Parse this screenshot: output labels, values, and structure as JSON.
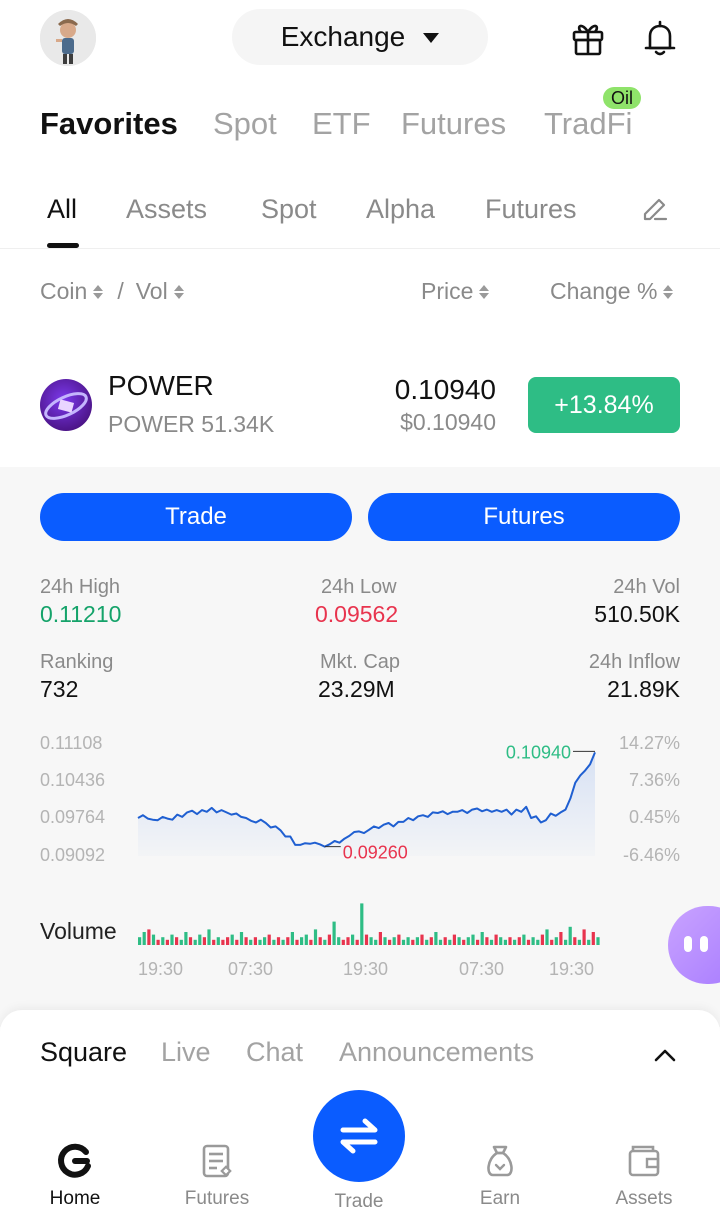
{
  "header": {
    "exchange_label": "Exchange",
    "icons": [
      "avatar",
      "chevron-down-icon",
      "gift-icon",
      "bell-icon"
    ]
  },
  "primary_tabs": [
    {
      "label": "Favorites",
      "active": true
    },
    {
      "label": "Spot",
      "active": false
    },
    {
      "label": "ETF",
      "active": false
    },
    {
      "label": "Futures",
      "active": false
    },
    {
      "label": "TradFi",
      "active": false,
      "badge": "Oil"
    }
  ],
  "secondary_tabs": [
    {
      "label": "All",
      "active": true
    },
    {
      "label": "Assets",
      "active": false
    },
    {
      "label": "Spot",
      "active": false
    },
    {
      "label": "Alpha",
      "active": false
    },
    {
      "label": "Futures",
      "active": false
    }
  ],
  "columns": {
    "coin": "Coin",
    "separator": "/",
    "vol": "Vol",
    "price": "Price",
    "change": "Change %"
  },
  "coin": {
    "symbol": "POWER",
    "sub": "POWER 51.34K",
    "price": "0.10940",
    "price_usd": "$0.10940",
    "change": "+13.84%",
    "colors": {
      "up": "#2ebd85",
      "down": "#e8344e",
      "accent": "#0a5cff"
    }
  },
  "actions": {
    "trade": "Trade",
    "futures": "Futures"
  },
  "stats": {
    "high_label": "24h High",
    "high": "0.11210",
    "low_label": "24h Low",
    "low": "0.09562",
    "vol_label": "24h Vol",
    "vol": "510.50K",
    "rank_label": "Ranking",
    "rank": "732",
    "cap_label": "Mkt. Cap",
    "cap": "23.29M",
    "inflow_label": "24h Inflow",
    "inflow": "21.89K"
  },
  "chart_data": {
    "type": "line",
    "y_ticks": [
      "0.11108",
      "0.10436",
      "0.09764",
      "0.09092"
    ],
    "y_pct_ticks": [
      "14.27%",
      "7.36%",
      "0.45%",
      "-6.46%"
    ],
    "ylim": [
      0.09092,
      0.11108
    ],
    "max_label": "0.10940",
    "min_label": "0.09260",
    "values": [
      0.0977,
      0.0982,
      0.0976,
      0.0974,
      0.0973,
      0.0979,
      0.0976,
      0.0974,
      0.0983,
      0.0979,
      0.0987,
      0.099,
      0.0984,
      0.0991,
      0.0988,
      0.0995,
      0.0987,
      0.0991,
      0.0987,
      0.0983,
      0.0985,
      0.0979,
      0.0977,
      0.0972,
      0.0969,
      0.0974,
      0.0968,
      0.096,
      0.0962,
      0.0955,
      0.0944,
      0.0944,
      0.0929,
      0.0929,
      0.0932,
      0.0931,
      0.0933,
      0.093,
      0.0926,
      0.093,
      0.0936,
      0.0933,
      0.094,
      0.0945,
      0.0952,
      0.0953,
      0.095,
      0.0956,
      0.0962,
      0.0959,
      0.0965,
      0.0968,
      0.0962,
      0.097,
      0.097,
      0.0977,
      0.0973,
      0.098,
      0.0982,
      0.0979,
      0.0987,
      0.0986,
      0.0989,
      0.0984,
      0.0988,
      0.0988,
      0.0991,
      0.0986,
      0.0992,
      0.0994,
      0.0989,
      0.0992,
      0.0988,
      0.0991,
      0.0988,
      0.0992,
      0.0983,
      0.0992,
      0.0988,
      0.0997,
      0.0977,
      0.098,
      0.0969,
      0.0973,
      0.0985,
      0.0981,
      0.0987,
      0.0992,
      0.1012,
      0.104,
      0.1053,
      0.1062,
      0.1073,
      0.1094
    ],
    "volume_label": "Volume",
    "volume": [
      3,
      5,
      6,
      4,
      2,
      3,
      2,
      4,
      3,
      2,
      5,
      3,
      2,
      4,
      3,
      6,
      2,
      3,
      2,
      3,
      4,
      2,
      5,
      3,
      2,
      3,
      2,
      3,
      4,
      2,
      3,
      2,
      3,
      5,
      2,
      3,
      4,
      2,
      6,
      3,
      2,
      4,
      9,
      3,
      2,
      3,
      4,
      2,
      16,
      4,
      3,
      2,
      5,
      3,
      2,
      3,
      4,
      2,
      3,
      2,
      3,
      4,
      2,
      3,
      5,
      2,
      3,
      2,
      4,
      3,
      2,
      3,
      4,
      2,
      5,
      3,
      2,
      4,
      3,
      2,
      3,
      2,
      3,
      4,
      2,
      3,
      2,
      4,
      6,
      2,
      3,
      5,
      2,
      7,
      3,
      2,
      6,
      2,
      5,
      3
    ],
    "volume_up": [
      true,
      true,
      false,
      true,
      false,
      true,
      false,
      true,
      false,
      true,
      true,
      false,
      true,
      true,
      false,
      true,
      false,
      true,
      false,
      false,
      true,
      false,
      true,
      false,
      true,
      false,
      true,
      true,
      false,
      true,
      false,
      true,
      false,
      true,
      false,
      true,
      true,
      false,
      true,
      false,
      true,
      false,
      true,
      true,
      false,
      false,
      true,
      false,
      true,
      false,
      true,
      true,
      false,
      true,
      false,
      true,
      false,
      true,
      true,
      false,
      true,
      false,
      true,
      false,
      true,
      true,
      false,
      true,
      false,
      true,
      false,
      true,
      true,
      false,
      true,
      false,
      true,
      false,
      true,
      true,
      false,
      true,
      false,
      true,
      false,
      true,
      true,
      false,
      true,
      false,
      true,
      false,
      true,
      true,
      false,
      true,
      false,
      true,
      false,
      true
    ],
    "x_labels": [
      "19:30",
      "07:30",
      "19:30",
      "07:30",
      "19:30"
    ]
  },
  "feed_tabs": [
    {
      "label": "Square",
      "active": true
    },
    {
      "label": "Live",
      "active": false
    },
    {
      "label": "Chat",
      "active": false
    },
    {
      "label": "Announcements",
      "active": false
    }
  ],
  "bottom_nav": [
    {
      "label": "Home",
      "active": true
    },
    {
      "label": "Futures",
      "active": false
    },
    {
      "label": "Trade",
      "active": false
    },
    {
      "label": "Earn",
      "active": false
    },
    {
      "label": "Assets",
      "active": false
    }
  ]
}
